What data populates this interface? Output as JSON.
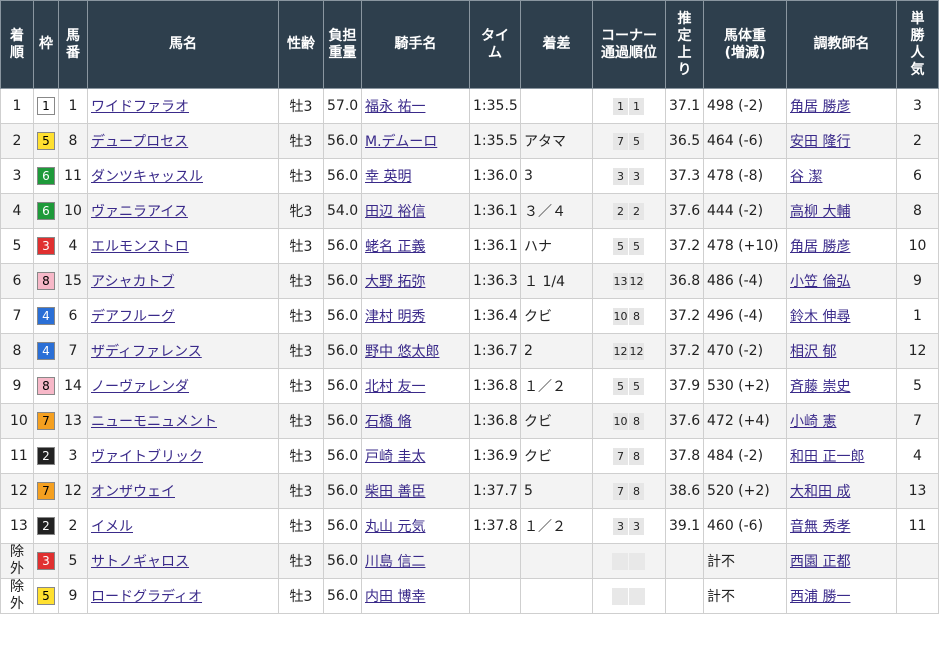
{
  "headers": {
    "rank": "着順",
    "waku": "枠",
    "umaban": "馬番",
    "horse": "馬名",
    "sexage": "性齢",
    "weight_carried": "負担重量",
    "jockey": "騎手名",
    "time": "タイム",
    "margin": "着差",
    "corner": "コーナー通過順位",
    "last3f": "推定上り",
    "body_weight": "馬体重(増減)",
    "trainer": "調教師名",
    "popularity": "単勝人気"
  },
  "waku_colors": {
    "1": {
      "bg": "#ffffff",
      "fg": "#000000"
    },
    "2": {
      "bg": "#222222",
      "fg": "#ffffff"
    },
    "3": {
      "bg": "#e03030",
      "fg": "#ffffff"
    },
    "4": {
      "bg": "#2a6fd6",
      "fg": "#ffffff"
    },
    "5": {
      "bg": "#ffe030",
      "fg": "#000000"
    },
    "6": {
      "bg": "#1e9a3a",
      "fg": "#ffffff"
    },
    "7": {
      "bg": "#f5a020",
      "fg": "#000000"
    },
    "8": {
      "bg": "#f7b8c8",
      "fg": "#000000"
    }
  },
  "rows": [
    {
      "rank": "1",
      "waku": "1",
      "umaban": "1",
      "horse": "ワイドファラオ",
      "sexage": "牡3",
      "weight": "57.0",
      "jockey": "福永 祐一",
      "time": "1:35.5",
      "margin": "",
      "corner": [
        "1",
        "1"
      ],
      "last3f": "37.1",
      "body_weight": "498 (-2)",
      "trainer": "角居 勝彦",
      "pop": "3"
    },
    {
      "rank": "2",
      "waku": "5",
      "umaban": "8",
      "horse": "デュープロセス",
      "sexage": "牡3",
      "weight": "56.0",
      "jockey": "M.デムーロ",
      "time": "1:35.5",
      "margin": "アタマ",
      "corner": [
        "7",
        "5"
      ],
      "last3f": "36.5",
      "body_weight": "464 (-6)",
      "trainer": "安田 隆行",
      "pop": "2"
    },
    {
      "rank": "3",
      "waku": "6",
      "umaban": "11",
      "horse": "ダンツキャッスル",
      "sexage": "牡3",
      "weight": "56.0",
      "jockey": "幸 英明",
      "time": "1:36.0",
      "margin": "3",
      "corner": [
        "3",
        "3"
      ],
      "last3f": "37.3",
      "body_weight": "478 (-8)",
      "trainer": "谷 潔",
      "pop": "6"
    },
    {
      "rank": "4",
      "waku": "6",
      "umaban": "10",
      "horse": "ヴァニラアイス",
      "sexage": "牝3",
      "weight": "54.0",
      "jockey": "田辺 裕信",
      "time": "1:36.1",
      "margin": "３／４",
      "corner": [
        "2",
        "2"
      ],
      "last3f": "37.6",
      "body_weight": "444 (-2)",
      "trainer": "高柳 大輔",
      "pop": "8"
    },
    {
      "rank": "5",
      "waku": "3",
      "umaban": "4",
      "horse": "エルモンストロ",
      "sexage": "牡3",
      "weight": "56.0",
      "jockey": "蛯名 正義",
      "time": "1:36.1",
      "margin": "ハナ",
      "corner": [
        "5",
        "5"
      ],
      "last3f": "37.2",
      "body_weight": "478 (+10)",
      "trainer": "角居 勝彦",
      "pop": "10"
    },
    {
      "rank": "6",
      "waku": "8",
      "umaban": "15",
      "horse": "アシャカトブ",
      "sexage": "牡3",
      "weight": "56.0",
      "jockey": "大野 拓弥",
      "time": "1:36.3",
      "margin": "１ 1/4",
      "corner": [
        "13",
        "12"
      ],
      "last3f": "36.8",
      "body_weight": "486 (-4)",
      "trainer": "小笠 倫弘",
      "pop": "9"
    },
    {
      "rank": "7",
      "waku": "4",
      "umaban": "6",
      "horse": "デアフルーグ",
      "sexage": "牡3",
      "weight": "56.0",
      "jockey": "津村 明秀",
      "time": "1:36.4",
      "margin": "クビ",
      "corner": [
        "10",
        "8"
      ],
      "last3f": "37.2",
      "body_weight": "496 (-4)",
      "trainer": "鈴木 伸尋",
      "pop": "1"
    },
    {
      "rank": "8",
      "waku": "4",
      "umaban": "7",
      "horse": "ザディファレンス",
      "sexage": "牡3",
      "weight": "56.0",
      "jockey": "野中 悠太郎",
      "time": "1:36.7",
      "margin": "2",
      "corner": [
        "12",
        "12"
      ],
      "last3f": "37.2",
      "body_weight": "470 (-2)",
      "trainer": "相沢 郁",
      "pop": "12"
    },
    {
      "rank": "9",
      "waku": "8",
      "umaban": "14",
      "horse": "ノーヴァレンダ",
      "sexage": "牡3",
      "weight": "56.0",
      "jockey": "北村 友一",
      "time": "1:36.8",
      "margin": "１／２",
      "corner": [
        "5",
        "5"
      ],
      "last3f": "37.9",
      "body_weight": "530 (+2)",
      "trainer": "斉藤 崇史",
      "pop": "5"
    },
    {
      "rank": "10",
      "waku": "7",
      "umaban": "13",
      "horse": "ニューモニュメント",
      "sexage": "牡3",
      "weight": "56.0",
      "jockey": "石橋 脩",
      "time": "1:36.8",
      "margin": "クビ",
      "corner": [
        "10",
        "8"
      ],
      "last3f": "37.6",
      "body_weight": "472 (+4)",
      "trainer": "小崎 憲",
      "pop": "7"
    },
    {
      "rank": "11",
      "waku": "2",
      "umaban": "3",
      "horse": "ヴァイトブリック",
      "sexage": "牡3",
      "weight": "56.0",
      "jockey": "戸崎 圭太",
      "time": "1:36.9",
      "margin": "クビ",
      "corner": [
        "7",
        "8"
      ],
      "last3f": "37.8",
      "body_weight": "484 (-2)",
      "trainer": "和田 正一郎",
      "pop": "4"
    },
    {
      "rank": "12",
      "waku": "7",
      "umaban": "12",
      "horse": "オンザウェイ",
      "sexage": "牡3",
      "weight": "56.0",
      "jockey": "柴田 善臣",
      "time": "1:37.7",
      "margin": "5",
      "corner": [
        "7",
        "8"
      ],
      "last3f": "38.6",
      "body_weight": "520 (+2)",
      "trainer": "大和田 成",
      "pop": "13"
    },
    {
      "rank": "13",
      "waku": "2",
      "umaban": "2",
      "horse": "イメル",
      "sexage": "牡3",
      "weight": "56.0",
      "jockey": "丸山 元気",
      "time": "1:37.8",
      "margin": "１／２",
      "corner": [
        "3",
        "3"
      ],
      "last3f": "39.1",
      "body_weight": "460 (-6)",
      "trainer": "音無 秀孝",
      "pop": "11"
    },
    {
      "rank": "除外",
      "waku": "3",
      "umaban": "5",
      "horse": "サトノギャロス",
      "sexage": "牡3",
      "weight": "56.0",
      "jockey": "川島 信二",
      "time": "",
      "margin": "",
      "corner": [
        "",
        ""
      ],
      "last3f": "",
      "body_weight": "計不",
      "trainer": "西園 正都",
      "pop": ""
    },
    {
      "rank": "除外",
      "waku": "5",
      "umaban": "9",
      "horse": "ロードグラディオ",
      "sexage": "牡3",
      "weight": "56.0",
      "jockey": "内田 博幸",
      "time": "",
      "margin": "",
      "corner": [
        "",
        ""
      ],
      "last3f": "",
      "body_weight": "計不",
      "trainer": "西浦 勝一",
      "pop": ""
    }
  ]
}
